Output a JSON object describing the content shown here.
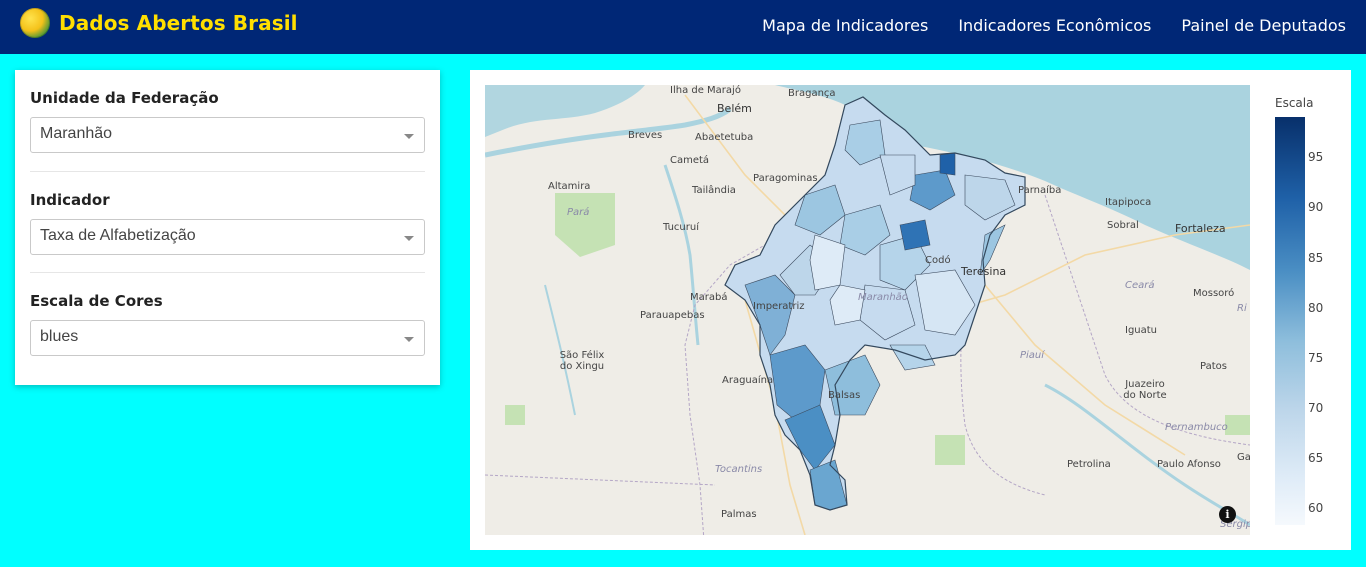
{
  "navbar": {
    "brand": "Dados Abertos Brasil",
    "links": [
      "Mapa de Indicadores",
      "Indicadores Econômicos",
      "Painel de Deputados"
    ]
  },
  "sidebar": {
    "uf_label": "Unidade da Federação",
    "uf_value": "Maranhão",
    "indicator_label": "Indicador",
    "indicator_value": "Taxa de Alfabetização",
    "scale_label": "Escala de Cores",
    "scale_value": "blues"
  },
  "map": {
    "labels": {
      "ilha_marajo": "Ilha de Marajó",
      "belem": "Belém",
      "braganca": "Bragança",
      "breves": "Breves",
      "abaetetuba": "Abaetetuba",
      "cameta": "Cametá",
      "paragominas": "Paragominas",
      "tailandia": "Tailândia",
      "altamira": "Altamira",
      "para": "Pará",
      "tucurui": "Tucuruí",
      "maraba": "Marabá",
      "parauapebas": "Parauapebas",
      "imperatriz": "Imperatriz",
      "sao_felix": "São Félix do Xingu",
      "araguaina": "Araguaína",
      "balsas": "Balsas",
      "tocantins": "Tocantins",
      "palmas": "Palmas",
      "maranhao": "Maranhão",
      "codo": "Codó",
      "teresina": "Teresina",
      "parnaiba": "Parnaíba",
      "itapipoca": "Itapipoca",
      "sobral": "Sobral",
      "fortaleza": "Fortaleza",
      "ceara": "Ceará",
      "mossoro": "Mossoró",
      "iguatu": "Iguatu",
      "piaui": "Piauí",
      "patos": "Patos",
      "juazeiro": "Juazeiro do Norte",
      "pernambuco": "Pernambuco",
      "petrolina": "Petrolina",
      "paulo_afonso": "Paulo Afonso",
      "ga": "Ga",
      "ri": "Ri",
      "sergipe": "Sergipe"
    },
    "info_icon": "info-icon"
  },
  "legend": {
    "title": "Escala",
    "ticks": [
      "95",
      "90",
      "85",
      "80",
      "75",
      "70",
      "65",
      "60"
    ],
    "range": [
      59,
      99
    ],
    "colors": [
      "#08306b",
      "#1f61a8",
      "#4b8fc4",
      "#8ebedc",
      "#bdd6ea",
      "#deebf7",
      "#f5f9fd"
    ]
  },
  "colors": {
    "navbar_bg": "#002776",
    "brand_text": "#ffdf00",
    "page_bg": "#00ffff"
  }
}
